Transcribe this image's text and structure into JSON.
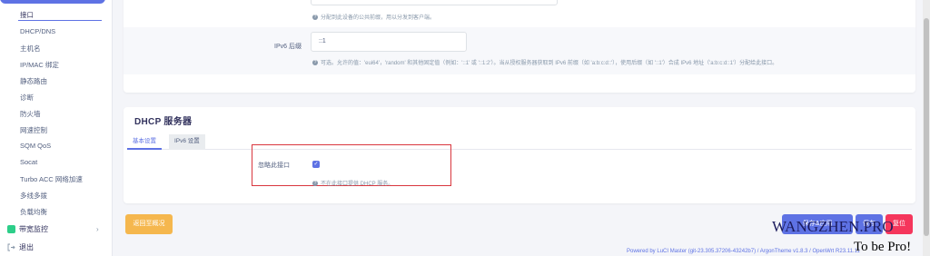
{
  "sidebar": {
    "items": [
      {
        "label": "接口",
        "active": true
      },
      {
        "label": "DHCP/DNS"
      },
      {
        "label": "主机名"
      },
      {
        "label": "IP/MAC 绑定"
      },
      {
        "label": "静态路由"
      },
      {
        "label": "诊断"
      },
      {
        "label": "防火墙"
      },
      {
        "label": "网速控制"
      },
      {
        "label": "SQM QoS"
      },
      {
        "label": "Socat"
      },
      {
        "label": "Turbo ACC 网络加速"
      },
      {
        "label": "多线多拨"
      },
      {
        "label": "负载均衡"
      }
    ],
    "bandwidth_label": "带宽监控",
    "bandwidth_chevron": "›",
    "logout_label": "退出"
  },
  "iface": {
    "assign_help": "分配到此设备的公共前缀，用以分发到客户端。",
    "ipv6_suffix_label": "IPv6 后缀",
    "ipv6_suffix_value": "::1",
    "ipv6_suffix_help": "可选。允许的值：'eui64'，'random' 和其他固定值（例如：'::1' 或 '::1:2'）。当从授权服务器获取到 IPv6 前缀（如 'a:b:c:d::'），使用后缀（如 '::1'）合成 IPv6 地址（'a:b:c:d::1'）分配给此接口。"
  },
  "dhcp": {
    "title": "DHCP 服务器",
    "tabs": [
      {
        "label": "基本设置",
        "active": true
      },
      {
        "label": "IPv6 设置"
      }
    ],
    "ignore_label": "忽略此接口",
    "ignore_checked": true,
    "ignore_help": "不在此接口提供 DHCP 服务。"
  },
  "actions": {
    "back_label": "返回至概况",
    "apply_label": "保存&应用",
    "save_label": "保存",
    "reset_label": "复位"
  },
  "footer": {
    "text": "Powered by LuCI Master (git-23.305.37206-43242b7) / ArgonTheme v1.8.3 / OpenWrt R23.11.11"
  },
  "watermark": {
    "line1": "WANGZHEN.PRO",
    "line2": "To be Pro!"
  },
  "colors": {
    "accent": "#5e72e4",
    "warning": "#f5b74e",
    "danger": "#f5365c",
    "highlight_box": "#d9363e"
  }
}
